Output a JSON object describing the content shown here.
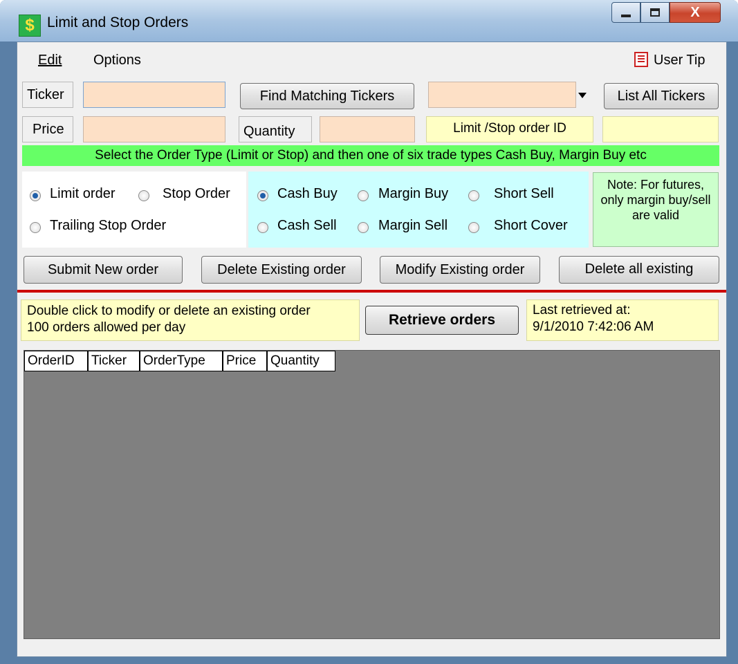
{
  "window": {
    "title": "Limit and Stop Orders",
    "icon": "dollar-icon",
    "min_glyph": "minimize-icon",
    "max_glyph": "maximize-icon",
    "close_glyph": "X"
  },
  "menu": {
    "edit": "Edit",
    "options": "Options",
    "user_tip": "User Tip"
  },
  "inputs": {
    "ticker_label": "Ticker",
    "price_label": "Price",
    "quantity_label": "Quantity",
    "order_id_label": "Limit /Stop order ID",
    "ticker_value": "",
    "price_value": "",
    "quantity_value": "",
    "order_id_value": "",
    "combo_value": ""
  },
  "buttons": {
    "find_matching": "Find Matching Tickers",
    "list_all": "List All Tickers",
    "submit": "Submit New order",
    "delete_existing": "Delete Existing order",
    "modify_existing": "Modify Existing order",
    "delete_all": "Delete all existing",
    "retrieve": "Retrieve orders"
  },
  "instruction": "Select the Order Type (Limit or Stop) and then one of six trade types Cash Buy, Margin Buy etc",
  "order_types": {
    "limit": "Limit order",
    "stop": "Stop Order",
    "trailing": "Trailing Stop Order",
    "selected": "Limit order"
  },
  "trade_types": {
    "cash_buy": "Cash Buy",
    "margin_buy": "Margin Buy",
    "short_sell": "Short Sell",
    "cash_sell": "Cash Sell",
    "margin_sell": "Margin Sell",
    "short_cover": "Short Cover",
    "selected": "Cash Buy"
  },
  "note": "Note: For futures, only margin buy/sell are valid",
  "info": {
    "line1": "Double click to modify or delete an existing order",
    "line2": "100 orders allowed per day",
    "retrieved_label": "Last retrieved at:",
    "retrieved_time": "9/1/2010 7:42:06 AM"
  },
  "grid": {
    "columns": [
      "OrderID",
      "Ticker",
      "OrderType",
      "Price",
      "Quantity"
    ]
  },
  "colors": {
    "peach": "#fde0c6",
    "yellow": "#ffffc4",
    "green_bar": "#66ff66",
    "cyan_panel": "#ccffff",
    "note_green": "#ccffcc",
    "separator": "#cc0000",
    "grid_bg": "#808080"
  }
}
